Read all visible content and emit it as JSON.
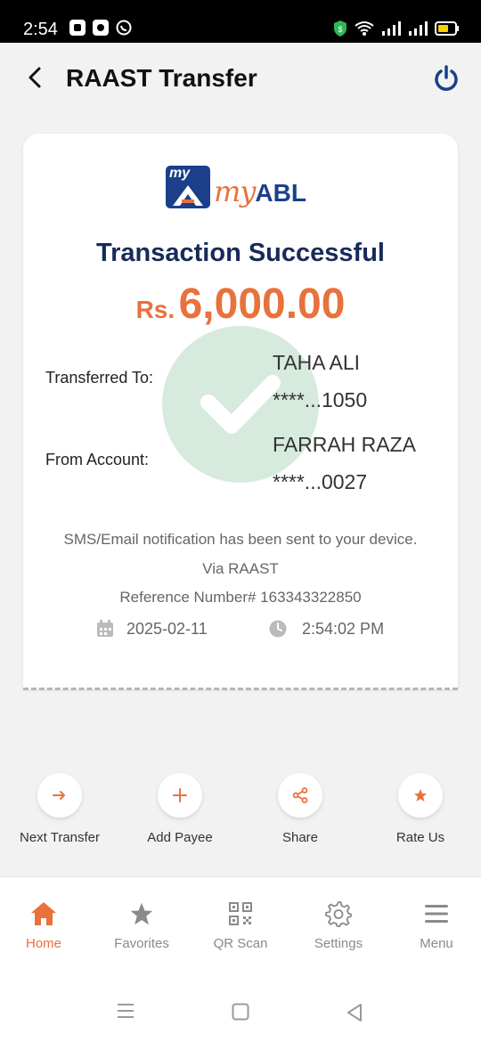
{
  "status_bar": {
    "time": "2:54"
  },
  "header": {
    "title": "RAAST Transfer"
  },
  "logo": {
    "badge": "my",
    "brand_my": "my",
    "brand_abl": "ABL"
  },
  "receipt": {
    "status": "Transaction Successful",
    "currency": "Rs.",
    "amount": "6,000.00",
    "transferred_to_label": "Transferred To:",
    "transferred_to_name": "TAHA ALI",
    "transferred_to_account": "****...1050",
    "from_account_label": "From Account:",
    "from_account_name": "FARRAH RAZA",
    "from_account_number": "****...0027",
    "notice": "SMS/Email notification has been sent to your device.",
    "via": "Via RAAST",
    "reference": "Reference Number# 163343322850",
    "date": "2025-02-11",
    "time": "2:54:02 PM"
  },
  "actions": [
    {
      "label": "Next Transfer",
      "icon": "arrow-right-icon"
    },
    {
      "label": "Add Payee",
      "icon": "plus-icon"
    },
    {
      "label": "Share",
      "icon": "share-icon"
    },
    {
      "label": "Rate Us",
      "icon": "star-icon"
    }
  ],
  "bottom_nav": [
    {
      "label": "Home",
      "icon": "home-icon",
      "active": true
    },
    {
      "label": "Favorites",
      "icon": "star-icon"
    },
    {
      "label": "QR Scan",
      "icon": "qr-icon"
    },
    {
      "label": "Settings",
      "icon": "gear-icon"
    },
    {
      "label": "Menu",
      "icon": "menu-icon"
    }
  ],
  "colors": {
    "accent": "#e8713c",
    "navy": "#172a5a",
    "success": "#d6eadd"
  }
}
